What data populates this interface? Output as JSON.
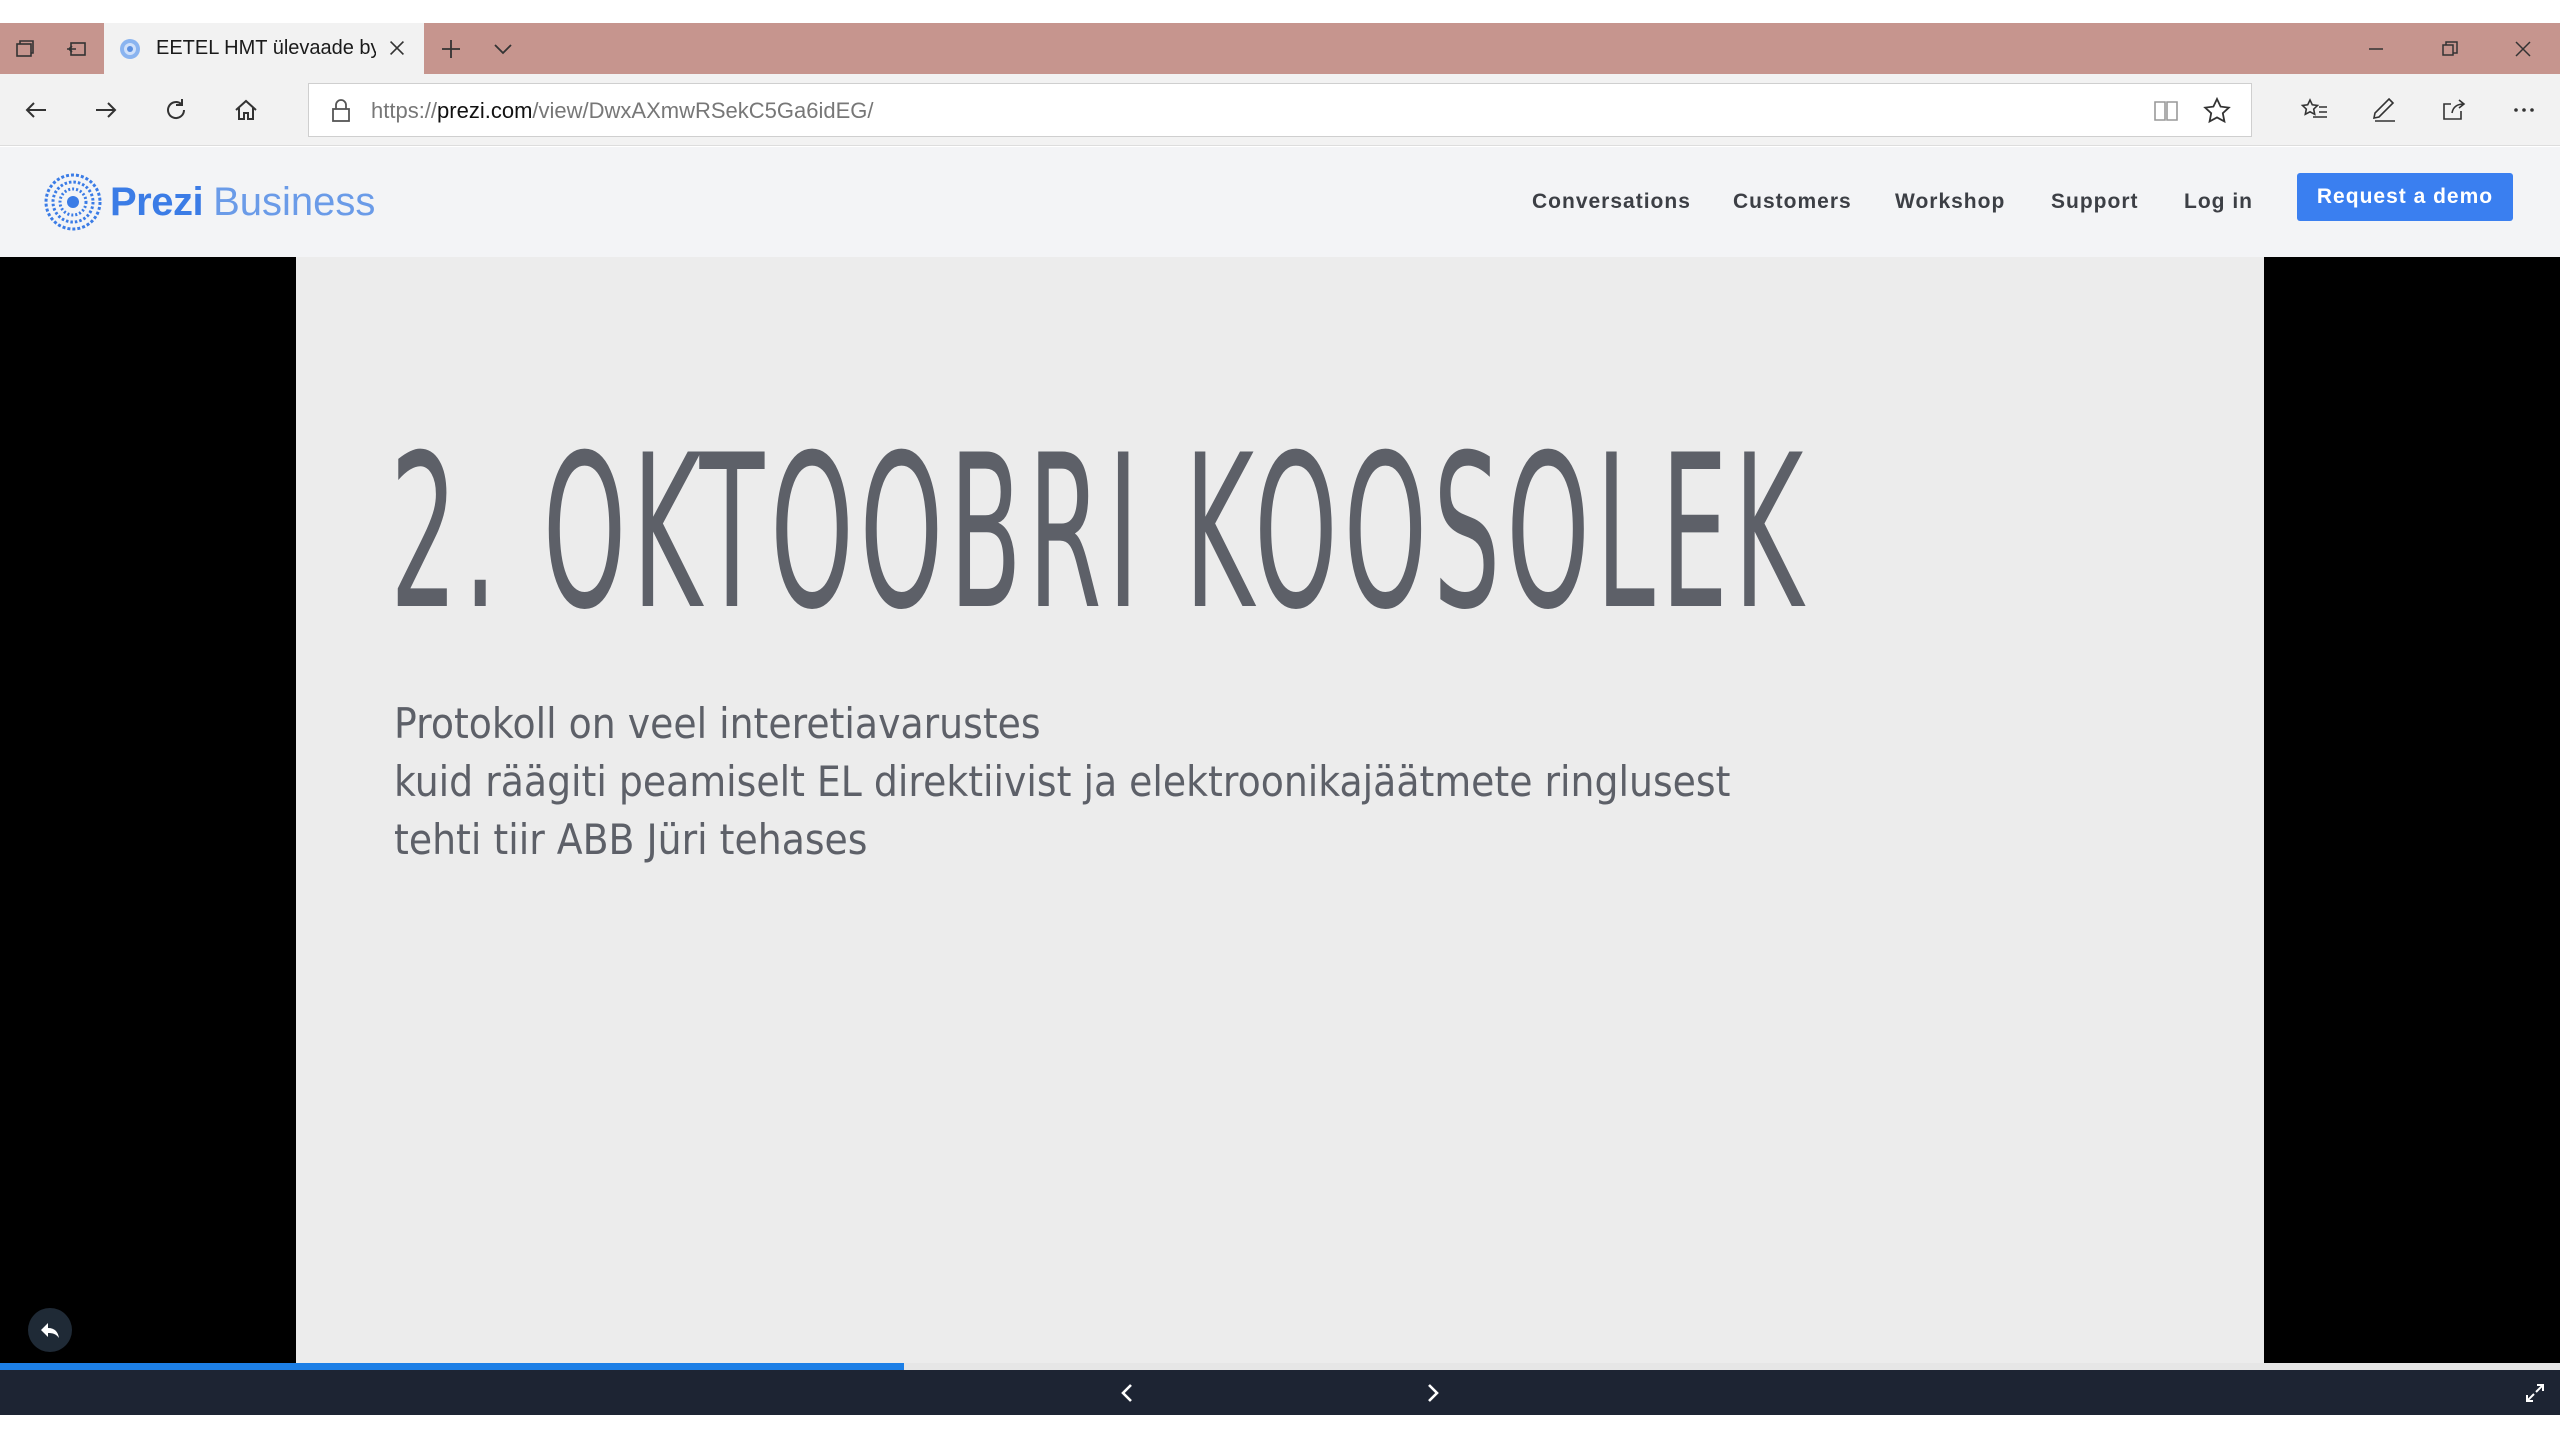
{
  "browser": {
    "tab_title": "EETEL HMT ülevaade by",
    "url_prefix": "https://",
    "url_host": "prezi.com",
    "url_path": "/view/DwxAXmwRSekC5Ga6idEG/"
  },
  "site": {
    "brand": "Prezi",
    "brand_sub": "Business",
    "nav": [
      "Conversations",
      "Customers",
      "Workshop",
      "Support",
      "Log in"
    ],
    "cta": "Request a demo"
  },
  "slide": {
    "title": "2. OKTOOBRI KOOSOLEK",
    "lines": [
      "Protokoll on veel interetiavarustes",
      "kuid räägiti peamiselt EL direktiivist ja elektroonikajäätmete ringlusest",
      "tehti tiir ABB Jüri tehases"
    ]
  },
  "viewer": {
    "progress_fraction": 0.353
  },
  "colors": {
    "tabbar": "#c6958e",
    "accent": "#3a7ff0",
    "progress": "#1d7fe6",
    "bottom_bar": "#1d2433"
  }
}
